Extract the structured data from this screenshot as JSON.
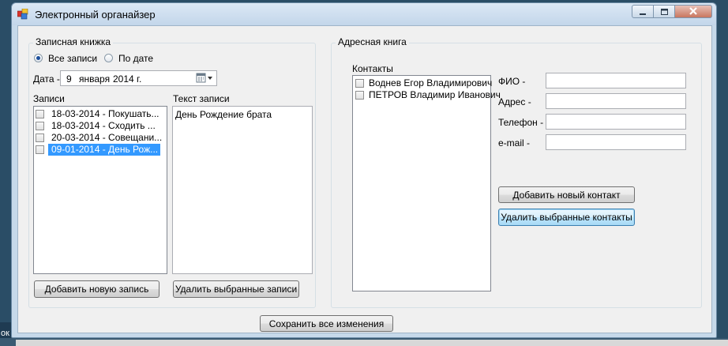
{
  "window": {
    "title": "Электронный органайзер"
  },
  "notebook": {
    "group_title": "Записная книжка",
    "radio_all": "Все записи",
    "radio_by_date": "По дате",
    "date_label": "Дата -",
    "date_day": "9",
    "date_month": "января",
    "date_year": "2014 г.",
    "entries_label": "Записи",
    "entries": [
      {
        "text": "18-03-2014 - Покушать...",
        "checked": false,
        "selected": false
      },
      {
        "text": "18-03-2014 - Сходить ...",
        "checked": false,
        "selected": false
      },
      {
        "text": "20-03-2014 - Совещани...",
        "checked": false,
        "selected": false
      },
      {
        "text": "09-01-2014 - День Рож...",
        "checked": false,
        "selected": true
      }
    ],
    "entry_text_label": "Текст записи",
    "entry_text_value": "День Рождение брата",
    "add_entry_button": "Добавить новую запись",
    "delete_entries_button": "Удалить выбранные записи"
  },
  "addressbook": {
    "group_title": "Адресная книга",
    "contacts_label": "Контакты",
    "contacts": [
      {
        "text": "Воднев Егор Владимирович",
        "checked": false
      },
      {
        "text": "ПЕТРОВ Владимир Иванович",
        "checked": false
      }
    ],
    "fio_label": "ФИО -",
    "address_label": "Адрес -",
    "phone_label": "Телефон -",
    "email_label": "e-mail -",
    "fio_value": "",
    "address_value": "",
    "phone_value": "",
    "email_value": "",
    "add_contact_button": "Добавить новый контакт",
    "delete_contacts_button": "Удалить выбранные контакты"
  },
  "save_button": "Сохранить все изменения",
  "taskbar_text": "ок",
  "colors": {
    "selection": "#3399ff",
    "title_bar": "#c3d6ea",
    "client_bg": "#f0f0f0"
  }
}
